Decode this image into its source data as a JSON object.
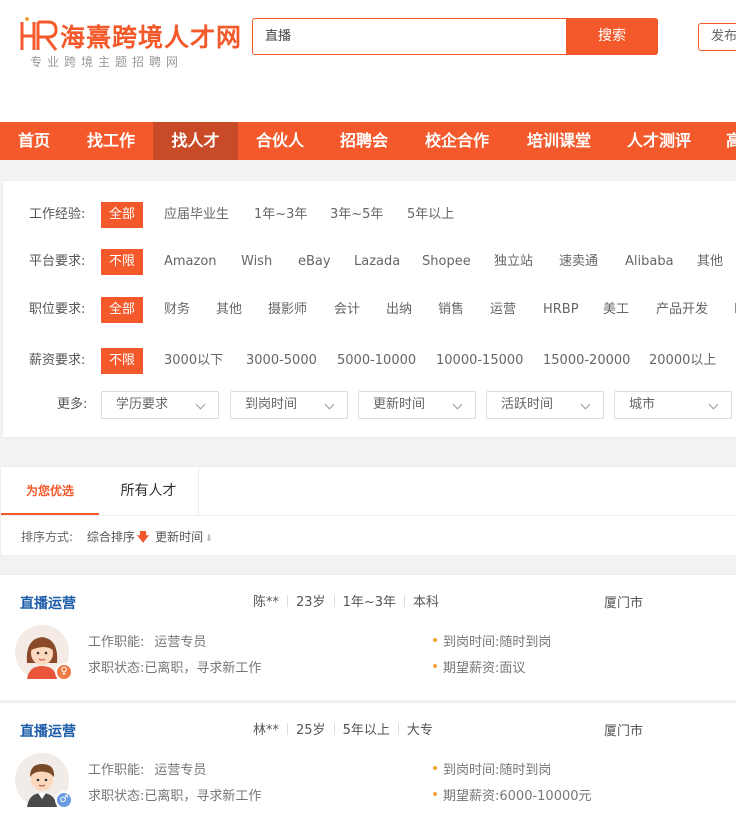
{
  "header": {
    "logo_title": "海熹跨境人才网",
    "logo_subtitle": "专业跨境主题招聘网",
    "search_placeholder": "直播",
    "search_button": "搜索",
    "publish_button": "发布"
  },
  "nav": {
    "items": [
      "首页",
      "找工作",
      "找人才",
      "合伙人",
      "招聘会",
      "校企合作",
      "培训课堂",
      "人才测评",
      "高"
    ],
    "active_index": 2
  },
  "filters": {
    "experience": {
      "label": "工作经验:",
      "options": [
        "全部",
        "应届毕业生",
        "1年~3年",
        "3年~5年",
        "5年以上"
      ]
    },
    "platform": {
      "label": "平台要求:",
      "options": [
        "不限",
        "Amazon",
        "Wish",
        "eBay",
        "Lazada",
        "Shopee",
        "独立站",
        "速卖通",
        "Alibaba",
        "其他"
      ]
    },
    "position": {
      "label": "职位要求:",
      "options": [
        "全部",
        "财务",
        "其他",
        "摄影师",
        "会计",
        "出纳",
        "销售",
        "运营",
        "HRBP",
        "美工",
        "产品开发",
        "I"
      ]
    },
    "salary": {
      "label": "薪资要求:",
      "options": [
        "不限",
        "3000以下",
        "3000-5000",
        "5000-10000",
        "10000-15000",
        "15000-20000",
        "20000以上"
      ]
    },
    "more": {
      "label": "更多:",
      "dropdowns": [
        "学历要求",
        "到岗时间",
        "更新时间",
        "活跃时间",
        "城市"
      ]
    }
  },
  "tabs": {
    "items": [
      "为您优选",
      "所有人才"
    ],
    "sort_label": "排序方式:",
    "sort_options": [
      "综合排序",
      "更新时间"
    ]
  },
  "candidates": [
    {
      "title": "直播运营",
      "name": "陈**",
      "age": "23岁",
      "experience": "1年~3年",
      "education": "本科",
      "city": "厦门市",
      "function_label": "工作职能:",
      "function_value": "运营专员",
      "status_label": "求职状态:",
      "status_value": "已离职，寻求新工作",
      "arrival_label": "到岗时间:",
      "arrival_value": "随时到岗",
      "salary_label": "期望薪资:",
      "salary_value": "面议",
      "gender": "female",
      "gender_symbol": "♀",
      "badge_color": "#f07a45"
    },
    {
      "title": "直播运营",
      "name": "林**",
      "age": "25岁",
      "experience": "5年以上",
      "education": "大专",
      "city": "厦门市",
      "function_label": "工作职能:",
      "function_value": "运营专员",
      "status_label": "求职状态:",
      "status_value": "已离职，寻求新工作",
      "arrival_label": "到岗时间:",
      "arrival_value": "随时到岗",
      "salary_label": "期望薪资:",
      "salary_value": "6000-10000元",
      "gender": "male",
      "gender_symbol": "♂",
      "badge_color": "#6a9be0"
    }
  ],
  "colors": {
    "accent": "#f4592b",
    "nav_active": "#c84a26",
    "link_blue": "#1d5ca8"
  }
}
